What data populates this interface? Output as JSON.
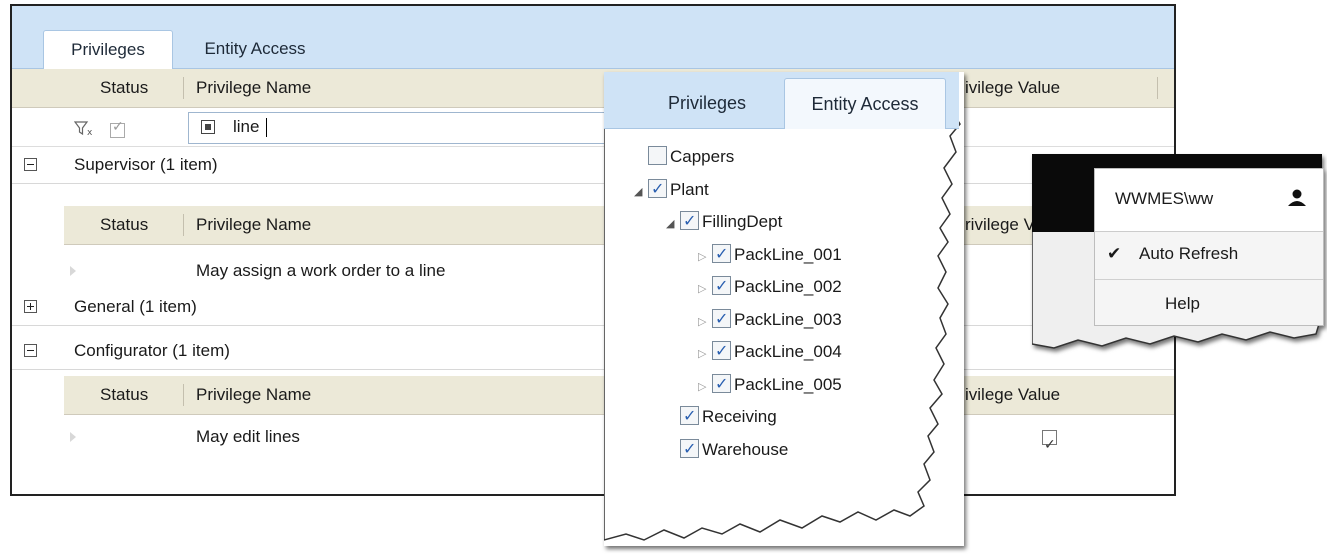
{
  "main": {
    "tabs": [
      {
        "label": "Privileges",
        "active": true
      },
      {
        "label": "Entity Access",
        "active": false
      }
    ],
    "columns": {
      "status": "Status",
      "name": "Privilege Name",
      "value": "Privilege Value"
    },
    "filter": {
      "text": "line"
    },
    "groups": [
      {
        "title": "Supervisor (1 item)",
        "expanded": true,
        "rows": [
          {
            "name": "May assign a work order to a line"
          }
        ]
      },
      {
        "title": "General (1 item)",
        "expanded": false,
        "rows": []
      },
      {
        "title": "Configurator (1 item)",
        "expanded": true,
        "rows": [
          {
            "name": "May edit lines",
            "value_checked": true
          }
        ]
      }
    ],
    "right_header_fragments": [
      "ivilege Value",
      "rivilege V",
      "ivilege Value"
    ]
  },
  "entity_panel": {
    "tabs": [
      {
        "label": "Privileges",
        "active": false
      },
      {
        "label": "Entity Access",
        "active": true
      }
    ],
    "tree": [
      {
        "label": "Cappers",
        "checked": false,
        "level": 0,
        "expander": "none"
      },
      {
        "label": "Plant",
        "checked": true,
        "level": 0,
        "expander": "open"
      },
      {
        "label": "FillingDept",
        "checked": true,
        "level": 1,
        "expander": "open"
      },
      {
        "label": "PackLine_001",
        "checked": true,
        "level": 2,
        "expander": "closed"
      },
      {
        "label": "PackLine_002",
        "checked": true,
        "level": 2,
        "expander": "closed"
      },
      {
        "label": "PackLine_003",
        "checked": true,
        "level": 2,
        "expander": "closed"
      },
      {
        "label": "PackLine_004",
        "checked": true,
        "level": 2,
        "expander": "closed"
      },
      {
        "label": "PackLine_005",
        "checked": true,
        "level": 2,
        "expander": "closed"
      },
      {
        "label": "Receiving",
        "checked": true,
        "level": 1,
        "expander": "none"
      },
      {
        "label": "Warehouse",
        "checked": true,
        "level": 1,
        "expander": "none"
      }
    ]
  },
  "user_menu": {
    "user": "WWMES\\ww",
    "items": [
      {
        "label": "Auto Refresh",
        "checked": true
      },
      {
        "label": "Help",
        "checked": false
      }
    ]
  },
  "colors": {
    "tab_bar": "#cfe3f6",
    "header_bg": "#ece9d8",
    "check_blue": "#2a5fb0",
    "dark_band": "#0a0a0a"
  }
}
